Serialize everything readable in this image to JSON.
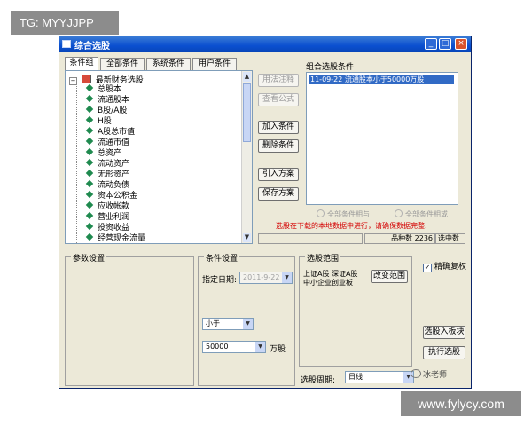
{
  "watermarks": {
    "top_left": "TG: MYYJJPP",
    "bottom_right": "www.fylycy.com",
    "logo_text": "冰老师"
  },
  "window": {
    "title": "综合选股",
    "min_label": "_",
    "max_label": "□",
    "close_label": "×"
  },
  "tabs": [
    "条件组",
    "全部条件",
    "系统条件",
    "用户条件"
  ],
  "tree": {
    "root_label": "最新财务选股",
    "items": [
      "总股本",
      "流通股本",
      "B股/A股",
      "H股",
      "A股总市值",
      "流通市值",
      "总资产",
      "流动资产",
      "无形资产",
      "流动负债",
      "资本公积金",
      "应收帐款",
      "营业利润",
      "投资收益",
      "经营现金流量"
    ]
  },
  "buttons": {
    "usage": "用法注释",
    "view_formula": "查看公式",
    "add_condition": "加入条件",
    "delete_condition": "删除条件",
    "import_scheme": "引入方案",
    "save_scheme": "保存方案",
    "change_range": "改变范围",
    "pick_to_block": "选股入板块",
    "execute_pick": "执行选股"
  },
  "combo": {
    "label": "组合选股条件",
    "items": [
      "11-09-22  流通股本小于50000万股"
    ]
  },
  "radios": {
    "all_true": "全部条件相与",
    "any_true": "全部条件相或"
  },
  "warning": "选股在下载的本地数据中进行，请确保数据完整.",
  "status": {
    "count_label": "品种数",
    "count_value": "2236",
    "selected_label": "选中数",
    "selected_value": ""
  },
  "params": {
    "label": "参数设置"
  },
  "condition": {
    "label": "条件设置",
    "date_label": "指定日期:",
    "date_value": "2011-9-22",
    "operator_value": "小于",
    "amount_value": "50000",
    "unit_label": "万股"
  },
  "range": {
    "label": "选股范围",
    "text": "上证A股 深证A股 中小企业创业板"
  },
  "exact": {
    "label": "精确复权",
    "checked": true
  },
  "period": {
    "label": "选股周期:",
    "value": "日线"
  }
}
